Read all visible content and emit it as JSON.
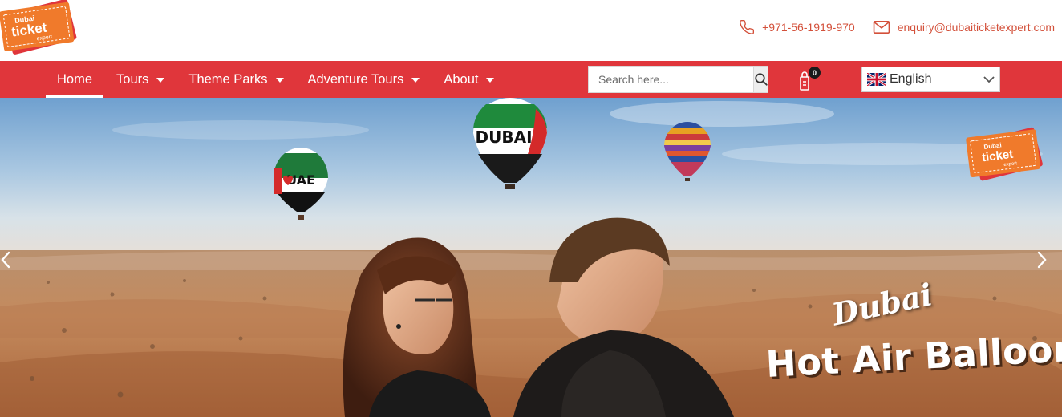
{
  "brand": {
    "logo_line1": "Dubai",
    "logo_line2": "ticket",
    "logo_line3": "expert",
    "accent_color": "#e0363b",
    "logo_color": "#f07a2b"
  },
  "contact": {
    "phone": "+971-56-1919-970",
    "email": "enquiry@dubaiticketexpert.com",
    "phone_icon": "phone-icon",
    "email_icon": "envelope-icon"
  },
  "nav": {
    "items": [
      {
        "label": "Home",
        "active": true,
        "has_dropdown": false
      },
      {
        "label": "Tours",
        "active": false,
        "has_dropdown": true
      },
      {
        "label": "Theme Parks",
        "active": false,
        "has_dropdown": true
      },
      {
        "label": "Adventure Tours",
        "active": false,
        "has_dropdown": true
      },
      {
        "label": "About",
        "active": false,
        "has_dropdown": true
      }
    ]
  },
  "search": {
    "placeholder": "Search here...",
    "value": "",
    "button_icon": "search-icon"
  },
  "cart": {
    "count": "0",
    "icon": "cart-icon"
  },
  "language": {
    "selected": "English",
    "flag_icon": "uk-flag-icon"
  },
  "hero": {
    "title_line1": "Dubai",
    "title_line2": "Hot Air Balloon",
    "balloon_text_1": "UAE",
    "balloon_text_2": "DUBAI",
    "prev_icon": "chevron-left-icon",
    "next_icon": "chevron-right-icon"
  }
}
